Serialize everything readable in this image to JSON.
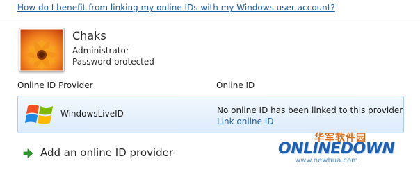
{
  "help_link": "How do I benefit from linking my online IDs with my Windows user account?",
  "user": {
    "name": "Chaks",
    "role": "Administrator",
    "protection": "Password protected",
    "avatar_icon": "orange-flower-icon"
  },
  "table": {
    "columns": [
      "Online ID Provider",
      "Online ID"
    ],
    "rows": [
      {
        "provider": "WindowsLiveID",
        "provider_icon": "windows-logo-icon",
        "status": "No online ID has been linked to this provider",
        "action": "Link online ID"
      }
    ]
  },
  "add_provider": {
    "label": "Add an online ID provider",
    "icon": "green-arrow-icon"
  },
  "watermark": {
    "chinese": "华军软件园",
    "brand": "ONLINEDOWN",
    "url": "www.newhua.com"
  },
  "colors": {
    "link": "#1a5ea8",
    "row_highlight": "#dcebfc",
    "row_border": "#a9cdf0",
    "watermark_orange": "#e06a12",
    "watermark_blue": "#1e5fb0"
  }
}
